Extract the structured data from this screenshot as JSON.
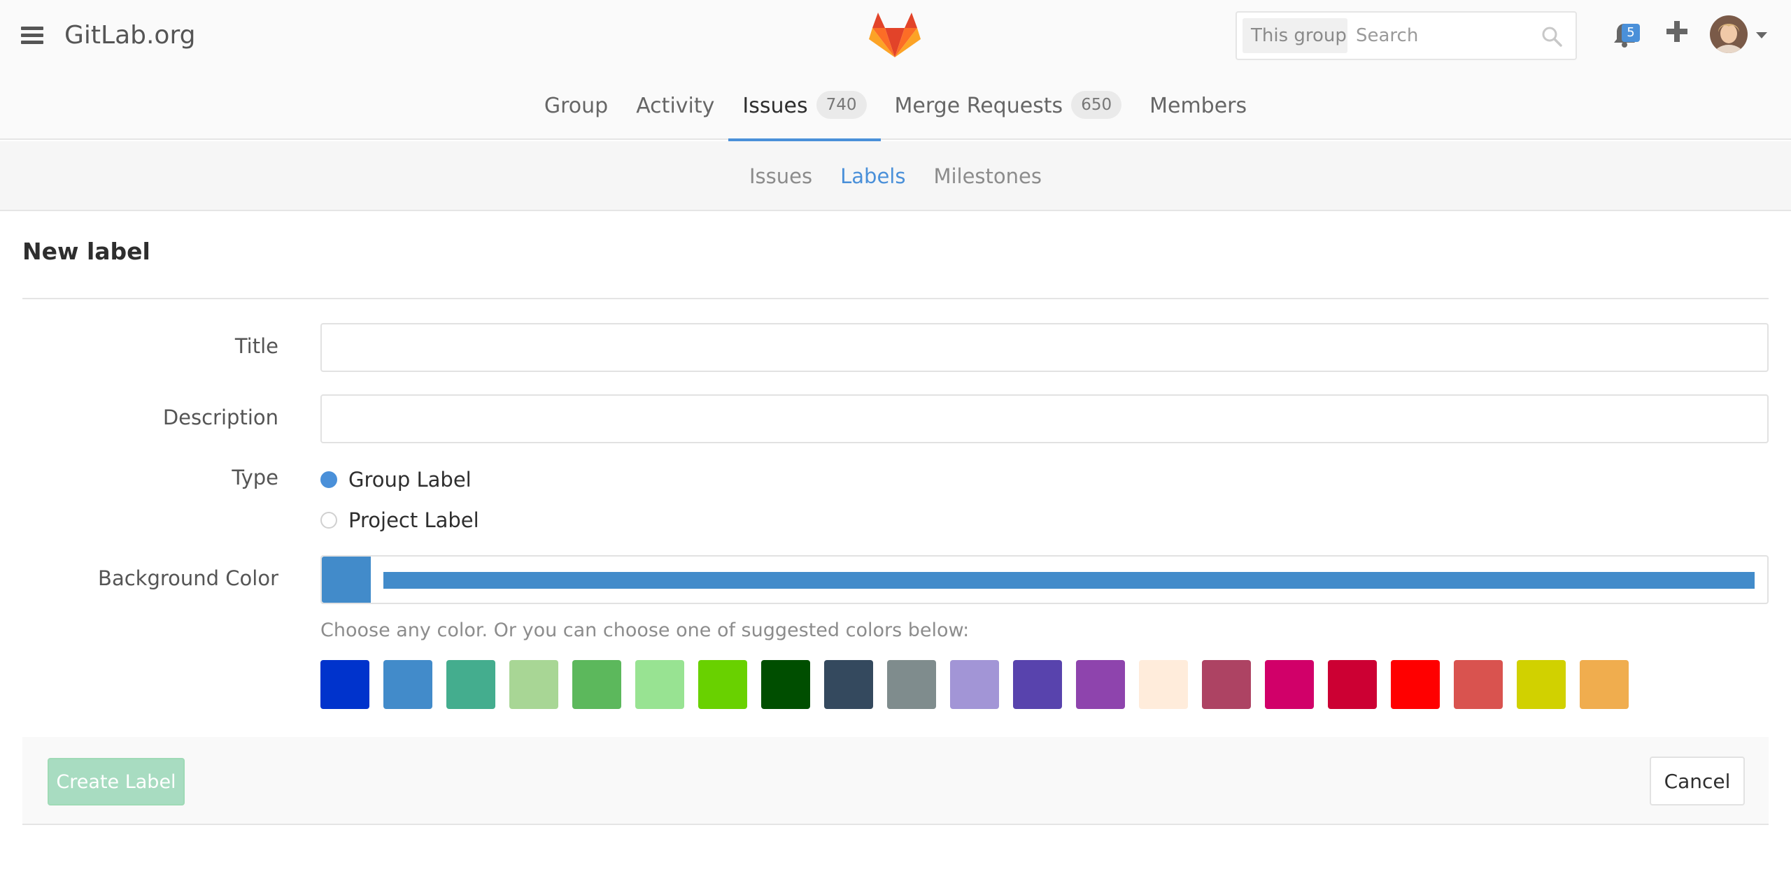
{
  "header": {
    "brand": "GitLab.org",
    "search": {
      "scope": "This group",
      "placeholder": "Search",
      "value": ""
    },
    "notifications_count": "5",
    "icons": [
      "hamburger-icon",
      "gitlab-logo-icon",
      "search-icon",
      "bell-icon",
      "plus-icon",
      "user-avatar",
      "caret-down-icon"
    ]
  },
  "nav": {
    "tabs": [
      {
        "label": "Group"
      },
      {
        "label": "Activity"
      },
      {
        "label": "Issues",
        "count": "740",
        "active": true
      },
      {
        "label": "Merge Requests",
        "count": "650"
      },
      {
        "label": "Members"
      }
    ]
  },
  "subnav": {
    "tabs": [
      {
        "label": "Issues"
      },
      {
        "label": "Labels",
        "active": true
      },
      {
        "label": "Milestones"
      }
    ]
  },
  "form": {
    "heading": "New label",
    "title_label": "Title",
    "title_value": "",
    "description_label": "Description",
    "description_value": "",
    "type_label": "Type",
    "type_options": [
      {
        "label": "Group Label",
        "checked": true
      },
      {
        "label": "Project Label",
        "checked": false
      }
    ],
    "bg_color_label": "Background Color",
    "bg_color_value": "#428BCA",
    "help_text": "Choose any color. Or you can choose one of suggested colors below:",
    "suggested_colors": [
      "#0033CC",
      "#428BCA",
      "#44AD8E",
      "#A8D695",
      "#5CB85C",
      "#98E392",
      "#69D100",
      "#004E00",
      "#34495E",
      "#7F8C8D",
      "#A295D6",
      "#5843AD",
      "#8E44AD",
      "#FFECDB",
      "#AD4363",
      "#D10069",
      "#CC0033",
      "#FF0000",
      "#D9534F",
      "#D1D100",
      "#F0AD4E"
    ],
    "create_label": "Create Label",
    "cancel_label": "Cancel"
  },
  "colors": {
    "accent": "#4a90d9",
    "create_button_disabled": "#a8dcc1"
  }
}
